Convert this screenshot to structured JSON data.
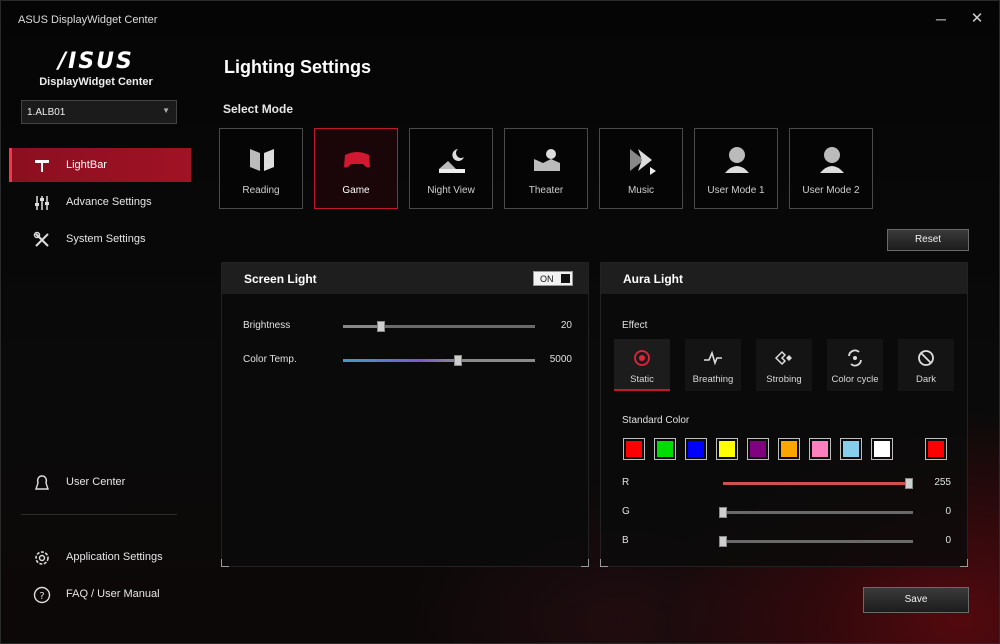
{
  "window": {
    "title": "ASUS DisplayWidget Center",
    "minimize": "─",
    "close": "✕"
  },
  "brand": {
    "logo_text": "/ISUS",
    "subtitle": "DisplayWidget Center"
  },
  "device": {
    "selected": "1.ALB01"
  },
  "nav": {
    "lightbar": "LightBar",
    "advance": "Advance Settings",
    "system": "System Settings",
    "user_center": "User Center",
    "app_settings": "Application Settings",
    "faq": "FAQ / User Manual"
  },
  "main": {
    "title": "Lighting Settings",
    "select_mode_label": "Select Mode",
    "modes": [
      "Reading",
      "Game",
      "Night View",
      "Theater",
      "Music",
      "User Mode 1",
      "User Mode 2"
    ],
    "selected_mode": "Game",
    "reset_label": "Reset",
    "save_label": "Save"
  },
  "screen_light": {
    "title": "Screen Light",
    "toggle_label": "ON",
    "brightness_label": "Brightness",
    "brightness_value": "20",
    "brightness_fraction": 0.2,
    "color_temp_label": "Color Temp.",
    "color_temp_value": "5000",
    "color_temp_fraction": 0.6
  },
  "aura_light": {
    "title": "Aura Light",
    "effect_label": "Effect",
    "effects": [
      "Static",
      "Breathing",
      "Strobing",
      "Color cycle",
      "Dark"
    ],
    "selected_effect": "Static",
    "standard_color_label": "Standard Color",
    "swatches": [
      "#ff0000",
      "#00dd00",
      "#0000ff",
      "#ffff00",
      "#800080",
      "#ffa500",
      "#ff7fbf",
      "#87ceeb",
      "#ffffff"
    ],
    "current_color": "#ff0000",
    "r_label": "R",
    "r_value": "255",
    "g_label": "G",
    "g_value": "0",
    "b_label": "B",
    "b_value": "0"
  },
  "colors": {
    "accent": "#c0182c",
    "nav_active": "#a01225"
  }
}
